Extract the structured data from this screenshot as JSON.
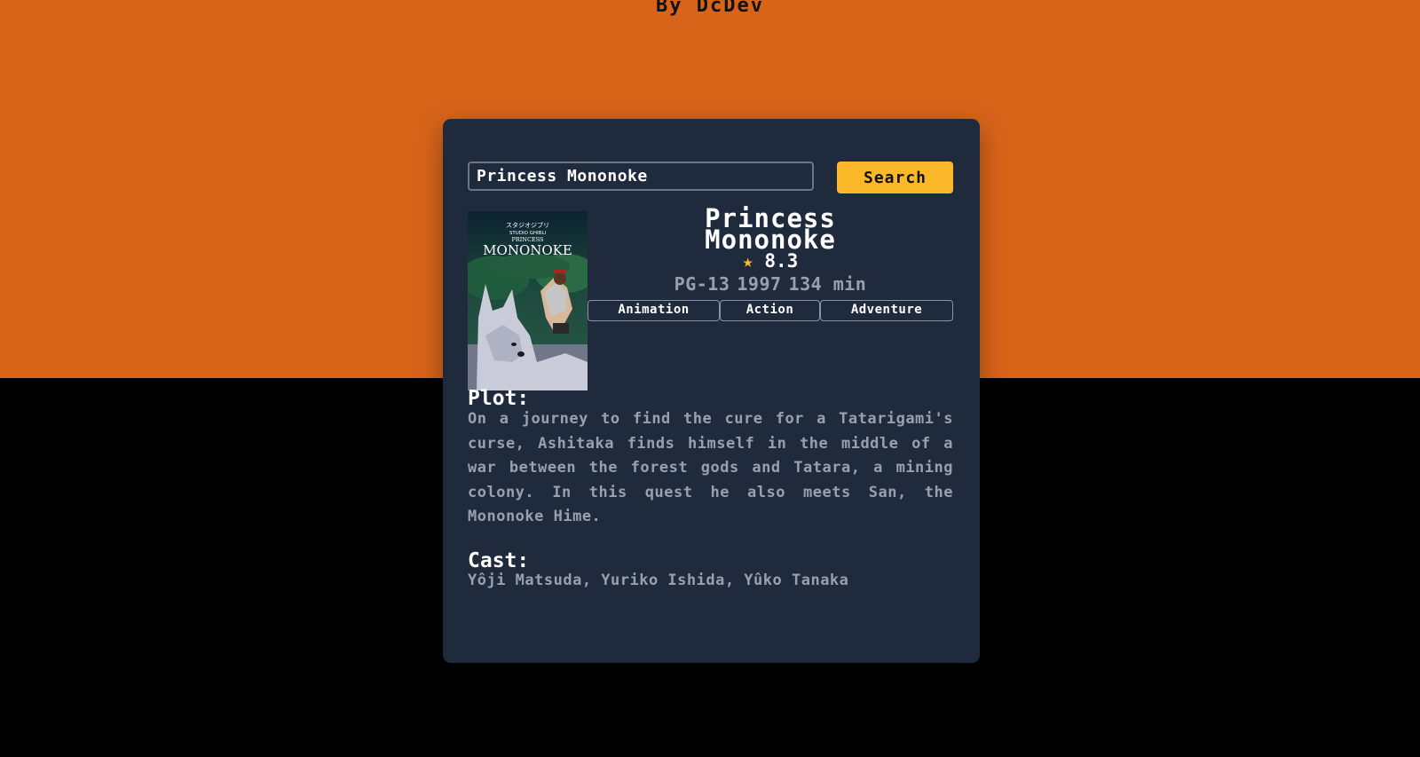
{
  "byline": "By DcDev",
  "search": {
    "value": "Princess Mononoke",
    "button_label": "Search"
  },
  "movie": {
    "title": "Princess Mononoke",
    "rating": "8.3",
    "star_icon": "star-icon",
    "rated": "PG-13",
    "year": "1997",
    "runtime": "134 min",
    "genres": [
      "Animation",
      "Action",
      "Adventure"
    ],
    "poster": {
      "studio_jp": "スタジオジブリ",
      "studio_en": "STUDIO GHIBLI",
      "line1": "PRINCESS",
      "line2": "MONONOKE"
    },
    "plot_heading": "Plot:",
    "plot": "On a journey to find the cure for a Tatarigami's curse, Ashitaka finds himself in the middle of a war between the forest gods and Tatara, a mining colony. In this quest he also meets San, the Mononoke Hime.",
    "cast_heading": "Cast:",
    "cast": "Yôji Matsuda, Yuriko Ishida, Yûko Tanaka"
  },
  "colors": {
    "background_top": "#d8641a",
    "background_bottom": "#000000",
    "card": "#1f2a3d",
    "accent": "#fbb829",
    "muted_text": "#9aa0ab"
  }
}
